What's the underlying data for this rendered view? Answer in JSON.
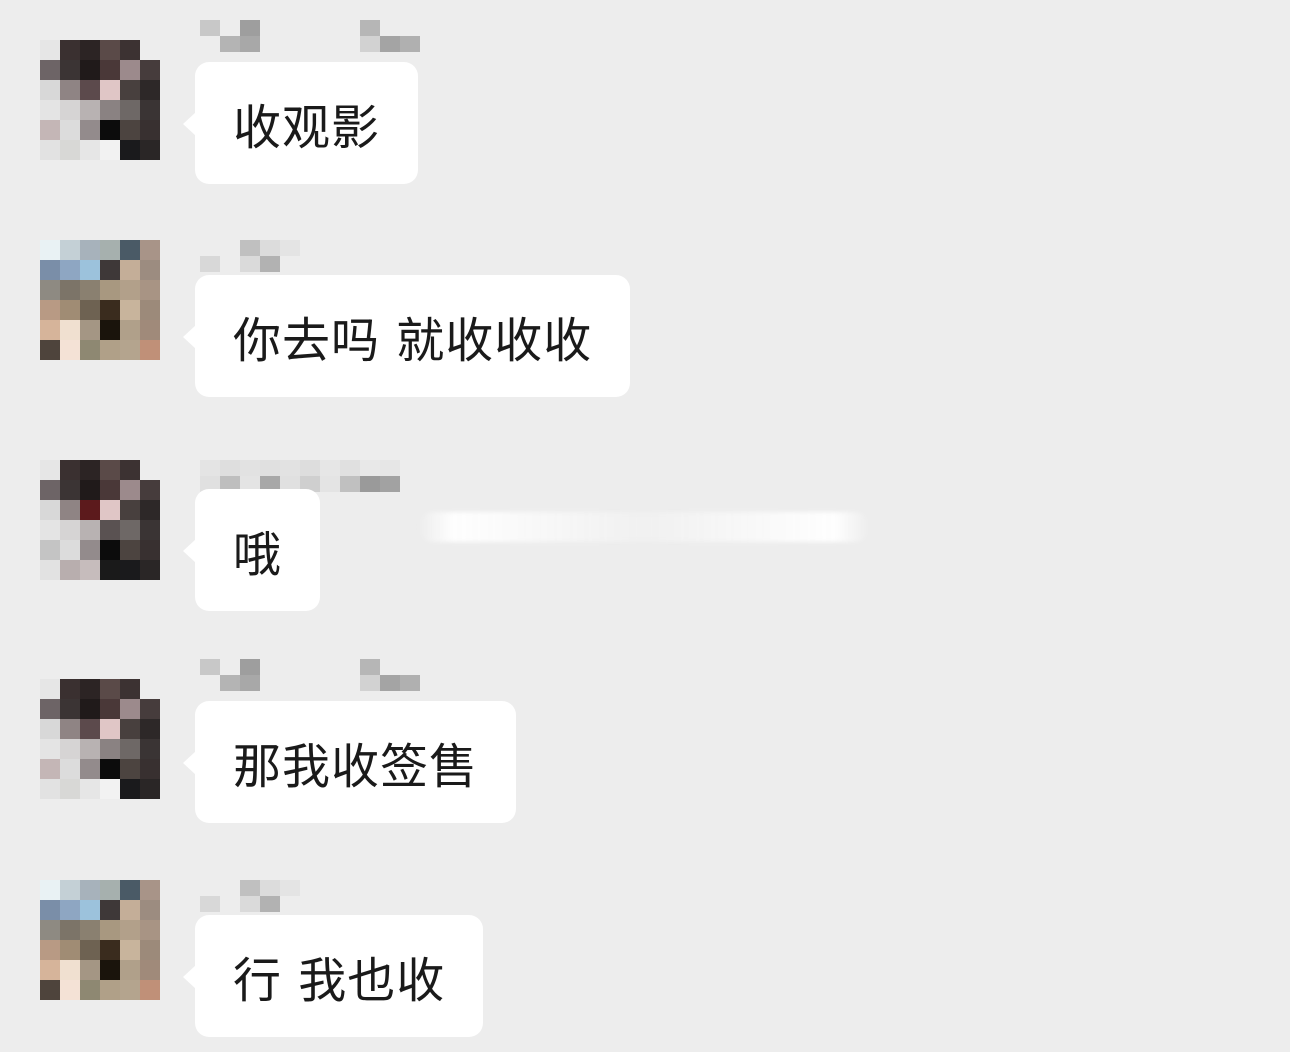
{
  "colors": {
    "background": "#ededed",
    "bubble": "#ffffff",
    "text": "#1a1a1a"
  },
  "messages": [
    {
      "text": "收观影",
      "avatar": "avatar-a"
    },
    {
      "text": "你去吗 就收收收",
      "avatar": "avatar-b"
    },
    {
      "text": "哦",
      "avatar": "avatar-a"
    },
    {
      "text": "那我收签售",
      "avatar": "avatar-a"
    },
    {
      "text": "行 我也收",
      "avatar": "avatar-b"
    }
  ]
}
